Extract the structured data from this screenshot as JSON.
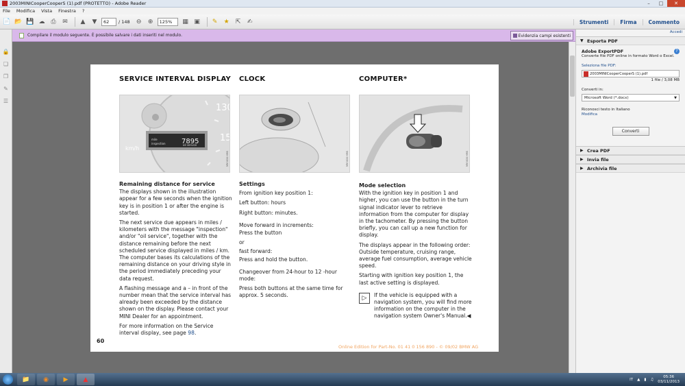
{
  "window": {
    "title": "2003MINICooperCooperS (1).pdf (PROTETTO) - Adobe Reader"
  },
  "menu": [
    "File",
    "Modifica",
    "Vista",
    "Finestra",
    "?"
  ],
  "toolbar": {
    "page_current": "62",
    "page_total": "/ 148",
    "zoom": "125%"
  },
  "right_tabs": [
    "Strumenti",
    "Firma",
    "Commento"
  ],
  "formbar": {
    "message": "Compilare il modulo seguente. È possibile salvare i dati inseriti nel modulo.",
    "highlight_label": "Evidenzia campi esistenti"
  },
  "panel": {
    "accedi": "Accedi",
    "export_header": "Esporta PDF",
    "app_title": "Adobe ExportPDF",
    "app_desc": "Converte file PDF online in formato Word o Excel.",
    "select_label": "Seleziona file PDF:",
    "file_name": "2003MINICooperCooperS (1).pdf",
    "file_info": "1 file / 3,08 MB",
    "convert_label": "Converti in:",
    "convert_value": "Microsoft Word (*.docx)",
    "ocr_label": "Riconosci testo in Italiano",
    "ocr_link": "Modifica",
    "convert_button": "Converti",
    "sections": [
      "Crea PDF",
      "Invia file",
      "Archivia file"
    ]
  },
  "page": {
    "headings": [
      "SERVICE INTERVAL DISPLAY",
      "CLOCK",
      "COMPUTER*"
    ],
    "speedo_display": {
      "value": "7895",
      "left": "mile\ninspection",
      "right": "oil\nservice"
    },
    "speedo_unit": "km/h",
    "speedo_numbers": [
      "130",
      "150"
    ],
    "image_codes": [
      "MM 000 HMS",
      "MM 000 HMS",
      "MM 000 HMS"
    ],
    "col1": {
      "title": "Remaining distance for service",
      "p": [
        "The displays shown in the illustration appear for a few seconds when the ignition key is in position 1 or after the engine is started.",
        "The next service due appears in miles / kilometers with the message \"inspection\" and/or \"oil service\", together with the distance remaining before the next scheduled service displayed in miles / km. The computer bases its calculations of the remaining distance on your driving style in the period immediately preceding your data request.",
        "A flashing message and a – in front of the number mean that the service interval has already been exceeded by the distance shown on the display. Please contact your MINI Dealer for an appointment."
      ],
      "last_pre": "For more information on the Service interval display, see page ",
      "last_link": "98",
      "last_post": "."
    },
    "col2": {
      "title": "Settings",
      "lines": [
        "From ignition key position 1:",
        "Left button: hours",
        "Right button: minutes.",
        "Move forward in increments:",
        "Press the button",
        "or",
        "fast forward:",
        "Press and hold the button.",
        "Changeover from 24-hour to 12 -hour mode:",
        "Press both buttons at the same time for approx. 5 seconds."
      ]
    },
    "col3": {
      "title": "Mode selection",
      "p": [
        "With the ignition key in position 1 and higher, you can use the button in the turn signal indicator lever to retrieve information from the computer for display in the tachometer. By pressing the button briefly, you can call up a new function for display.",
        "The displays appear in the following order: Outside temperature, cruising range, average fuel consumption, average vehicle speed.",
        "Starting with ignition key position 1, the last active setting is displayed."
      ],
      "note": "If the vehicle is equipped with a navigation system, you will find more information on the computer in the navigation system Owner's Manual.◀"
    },
    "page_number": "60",
    "footer": "Online Edition for Part-No. 01 41 0 156 890 - © 09/02 BMW AG"
  },
  "taskbar": {
    "lang": "IT",
    "time": "05:36",
    "date": "03/11/2013"
  }
}
